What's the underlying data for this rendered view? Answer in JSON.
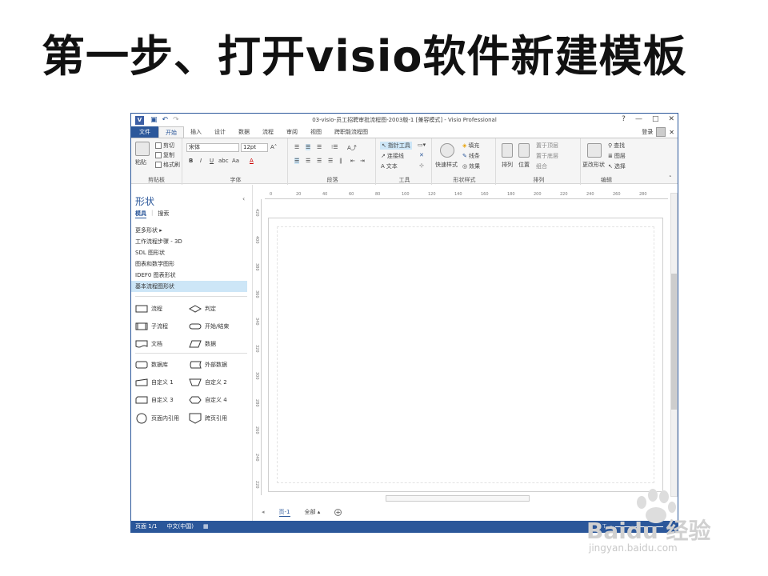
{
  "slide_title": "第一步、打开visio软件新建模板",
  "app": {
    "window_title": "03-visio-员工招聘审批流程图-2003版-1 [兼容模式] - Visio Professional",
    "app_icon_text": "V",
    "quick_access": [
      "save-icon",
      "undo-icon",
      "redo-icon"
    ],
    "window_controls": [
      "?",
      "—",
      "□",
      "✕"
    ],
    "sign_in": "登录",
    "tabs": [
      {
        "label": "文件"
      },
      {
        "label": "开始"
      },
      {
        "label": "插入"
      },
      {
        "label": "设计"
      },
      {
        "label": "数据"
      },
      {
        "label": "流程"
      },
      {
        "label": "审阅"
      },
      {
        "label": "视图"
      },
      {
        "label": "跨职能流程图"
      }
    ],
    "active_tab": "开始",
    "ribbon": {
      "clipboard": {
        "label": "剪贴板",
        "paste": "粘贴",
        "cut": "剪切",
        "copy": "复制",
        "format_painter": "格式刷"
      },
      "font": {
        "label": "字体",
        "font_name": "宋体",
        "font_size": "12pt",
        "grow": "A˄",
        "shrink": "A˅",
        "bold": "B",
        "italic": "I",
        "underline": "U",
        "strike": "abc",
        "case": "Aa",
        "font_color": "A"
      },
      "paragraph": {
        "label": "段落"
      },
      "tools": {
        "label": "工具",
        "pointer": "指针工具",
        "connector": "连接线",
        "text": "文本"
      },
      "shape_styles": {
        "label": "形状样式",
        "quick_styles": "快速样式",
        "fill": "填充",
        "line": "线条",
        "effects": "效果"
      },
      "arrange": {
        "label": "排列",
        "align": "排列",
        "position": "位置",
        "bring_front": "置于顶层",
        "send_back": "置于底层",
        "group": "组合"
      },
      "editing": {
        "label": "编辑",
        "change_shape": "更改形状",
        "find": "查找",
        "layers": "图层",
        "select": "选择"
      }
    },
    "shapes_pane": {
      "title": "形状",
      "tabs": [
        "模具",
        "搜索"
      ],
      "stencils": [
        {
          "label": "更多形状 ▸"
        },
        {
          "label": "工作流程步骤 - 3D"
        },
        {
          "label": "SDL 图形状"
        },
        {
          "label": "图表和数学图形"
        },
        {
          "label": "IDEF0 图表形状"
        },
        {
          "label": "基本流程图形状"
        }
      ],
      "selected_stencil": "基本流程图形状",
      "shape_items": [
        {
          "label": "流程",
          "icon": "process-shape-icon"
        },
        {
          "label": "判定",
          "icon": "decision-shape-icon"
        },
        {
          "label": "子流程",
          "icon": "subprocess-shape-icon"
        },
        {
          "label": "开始/结束",
          "icon": "start-end-shape-icon"
        },
        {
          "label": "文档",
          "icon": "document-shape-icon"
        },
        {
          "label": "数据",
          "icon": "data-shape-icon"
        },
        {
          "label": "数据库",
          "icon": "database-shape-icon"
        },
        {
          "label": "外部数据",
          "icon": "external-data-shape-icon"
        },
        {
          "label": "自定义 1",
          "icon": "custom1-shape-icon"
        },
        {
          "label": "自定义 2",
          "icon": "custom2-shape-icon"
        },
        {
          "label": "自定义 3",
          "icon": "custom3-shape-icon"
        },
        {
          "label": "自定义 4",
          "icon": "custom4-shape-icon"
        },
        {
          "label": "页面内引用",
          "icon": "on-page-reference-icon"
        },
        {
          "label": "跨页引用",
          "icon": "off-page-reference-icon"
        }
      ]
    },
    "ruler_top_ticks": [
      "0",
      "20",
      "40",
      "60",
      "80",
      "100",
      "120",
      "140",
      "160",
      "180",
      "200",
      "220",
      "240",
      "260",
      "280"
    ],
    "ruler_left_ticks": [
      "420",
      "400",
      "380",
      "360",
      "340",
      "320",
      "300",
      "280",
      "260",
      "240",
      "220"
    ],
    "page_tabs": {
      "current": "页-1",
      "all": "全部 ▴",
      "add": "+"
    },
    "status": {
      "page": "页面 1/1",
      "language": "中文(中国)",
      "zoom_minus": "-",
      "zoom_plus": "+"
    }
  },
  "watermark": {
    "brand": "Baidu 经验",
    "url": "jingyan.baidu.com"
  }
}
